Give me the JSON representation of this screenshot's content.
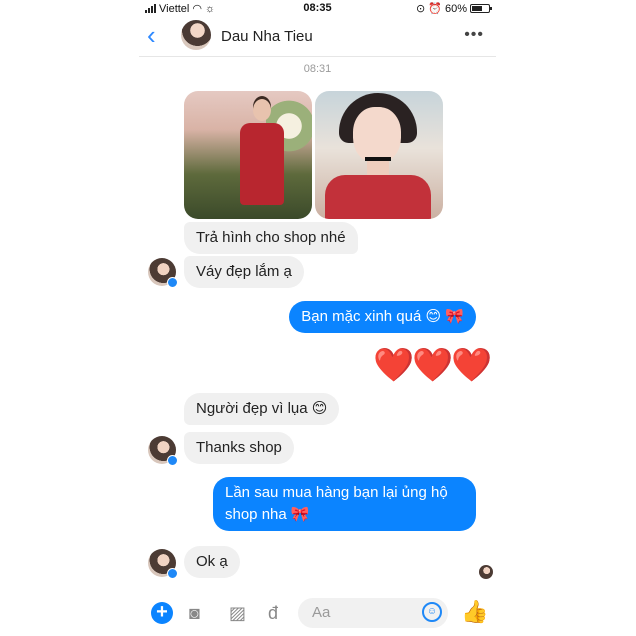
{
  "status_bar": {
    "carrier": "Viettel",
    "time": "08:35",
    "battery_label": "60%",
    "battery_level": 0.6,
    "icons": [
      "signal-icon",
      "wifi-icon",
      "brightness-icon",
      "lock-rotation-icon",
      "alarm-icon",
      "battery-icon"
    ]
  },
  "header": {
    "back_icon": "chevron-left-icon",
    "contact_name": "Dau Nha Tieu",
    "more_icon": "more-dots-icon"
  },
  "timestamp": "08:31",
  "messages": [
    {
      "from": "contact",
      "type": "photos",
      "count": 2
    },
    {
      "from": "contact",
      "text": "Trả hình cho shop nhé"
    },
    {
      "from": "contact",
      "text": "Váy đẹp lắm ạ"
    },
    {
      "from": "me",
      "text": "Bạn mặc xinh quá 😊 🎀"
    },
    {
      "from": "me",
      "text": "❤️❤️❤️",
      "type": "emoji"
    },
    {
      "from": "contact",
      "text": "Người đẹp vì lụa 😊"
    },
    {
      "from": "contact",
      "text": "Thanks shop"
    },
    {
      "from": "me",
      "text": "Lần sau mua hàng bạn lại ủng hộ shop nha 🎀"
    },
    {
      "from": "contact",
      "text": "Ok ạ"
    }
  ],
  "composer": {
    "placeholder": "Aa",
    "icons": [
      "plus-icon",
      "camera-icon",
      "image-icon",
      "currency-dong-icon",
      "emoji-icon",
      "thumbs-up-icon"
    ],
    "accent_color": "#0b84ff"
  },
  "colors": {
    "outgoing_bubble": "#0b84ff",
    "incoming_bubble": "#f0f0f0",
    "heart": "#e0301e"
  }
}
